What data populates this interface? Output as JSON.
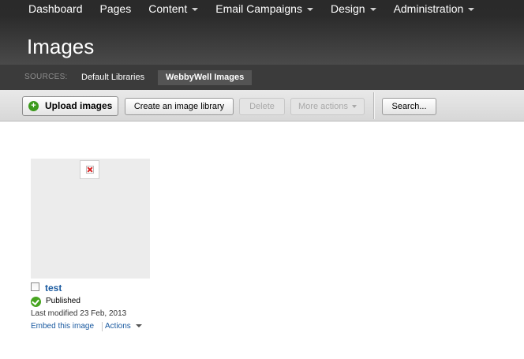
{
  "nav": {
    "items": [
      {
        "label": "Dashboard",
        "dropdown": false
      },
      {
        "label": "Pages",
        "dropdown": false
      },
      {
        "label": "Content",
        "dropdown": true
      },
      {
        "label": "Email Campaigns",
        "dropdown": true
      },
      {
        "label": "Design",
        "dropdown": true
      },
      {
        "label": "Administration",
        "dropdown": true
      }
    ]
  },
  "page": {
    "title": "Images"
  },
  "sources": {
    "label": "SOURCES:",
    "items": [
      {
        "label": "Default Libraries",
        "active": false
      },
      {
        "label": "WebbyWell Images",
        "active": true
      }
    ]
  },
  "toolbar": {
    "upload_label": "Upload images",
    "create_library_label": "Create an image library",
    "delete_label": "Delete",
    "more_actions_label": "More actions",
    "search_label": "Search..."
  },
  "images": [
    {
      "name": "test",
      "status": "Published",
      "modified": "Last modified 23 Feb, 2013",
      "embed_label": "Embed this image",
      "actions_label": "Actions"
    }
  ],
  "colors": {
    "header_dark": "#2b2b2b",
    "link_blue": "#1a5aa0",
    "published_green": "#48a521"
  }
}
